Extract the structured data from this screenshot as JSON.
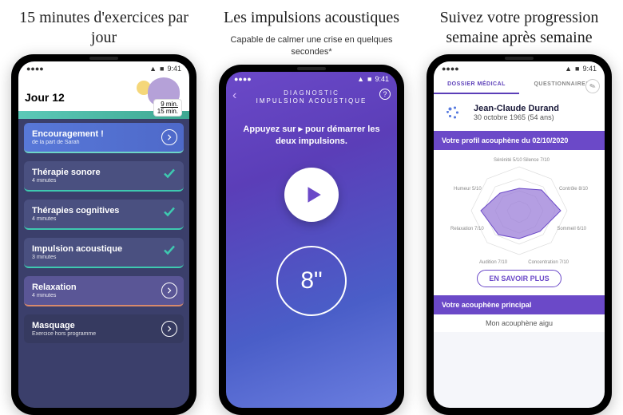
{
  "statusbar": {
    "time": "9:41"
  },
  "panel1": {
    "headline": "15 minutes d'exercices par jour",
    "day_label": "Jour 12",
    "time_done": "9 min.",
    "time_total": "15 min.",
    "encour": {
      "title": "Encouragement !",
      "sub": "de la part de Sarah"
    },
    "items": [
      {
        "title": "Thérapie sonore",
        "sub": "4 minutes",
        "done": true
      },
      {
        "title": "Thérapies cognitives",
        "sub": "4 minutes",
        "done": true
      },
      {
        "title": "Impulsion acoustique",
        "sub": "3 minutes",
        "done": true
      },
      {
        "title": "Relaxation",
        "sub": "4 minutes",
        "done": false
      }
    ],
    "mask": {
      "title": "Masquage",
      "sub": "Exercice hors programme"
    }
  },
  "panel2": {
    "headline": "Les impulsions acoustiques",
    "sub": "Capable de calmer une crise en quelques secondes*",
    "diag_title": "DIAGNOSTIC",
    "diag_sub": "IMPULSION ACOUSTIQUE",
    "instruction": "Appuyez sur ▸ pour démarrer les deux impulsions.",
    "timer": "8\""
  },
  "panel3": {
    "headline": "Suivez votre progression semaine après semaine",
    "tabs": {
      "medical": "DOSSIER MÉDICAL",
      "quest": "QUESTIONNAIRES"
    },
    "profile": {
      "name": "Jean-Claude Durand",
      "dob": "30 octobre 1965 (54 ans)"
    },
    "profile_title": "Votre profil acouphène du 02/10/2020",
    "radar_labels": {
      "serenite": "Sérénité 5/10",
      "silence": "Silence 7/10",
      "humeur": "Humeur 5/10",
      "controle": "Contrôle 8/10",
      "relaxation": "Relaxation 7/10",
      "sommeil": "Sommeil 6/10",
      "audition": "Audition 7/10",
      "concentration": "Concentration 7/10"
    },
    "more_btn": "EN SAVOIR PLUS",
    "main_title": "Votre acouphène principal",
    "aigu": "Mon acouphène aigu"
  },
  "chart_data": {
    "type": "radar",
    "title": "Votre profil acouphène du 02/10/2020",
    "categories": [
      "Sérénité",
      "Silence",
      "Contrôle",
      "Sommeil",
      "Concentration",
      "Audition",
      "Relaxation",
      "Humeur"
    ],
    "values": [
      5,
      7,
      8,
      6,
      7,
      7,
      7,
      5
    ],
    "max": 10
  }
}
